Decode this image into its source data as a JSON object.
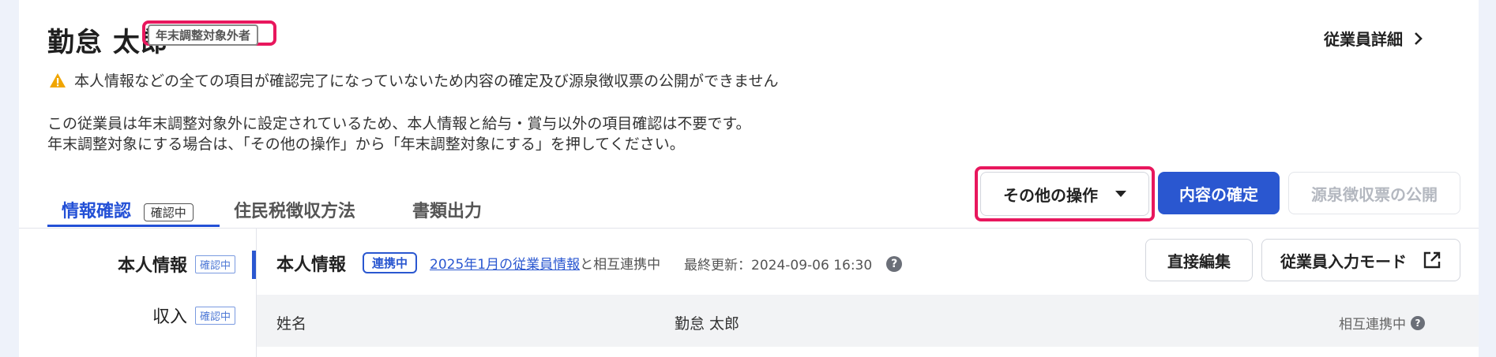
{
  "employee": {
    "name": "勤怠 太郎",
    "exclusion_badge": "年末調整対象外者",
    "detail_link": "従業員詳細"
  },
  "warning": "本人情報などの全ての項目が確認完了になっていないため内容の確定及び源泉徴収票の公開ができません",
  "info": {
    "line1": "この従業員は年末調整対象外に設定されているため、本人情報と給与・賞与以外の項目確認は不要です。",
    "line2": "年末調整対象にする場合は、「その他の操作」から「年末調整対象にする」を押してください。"
  },
  "tabs": [
    {
      "label": "情報確認",
      "chip": "確認中"
    },
    {
      "label": "住民税徴収方法"
    },
    {
      "label": "書類出力"
    }
  ],
  "actions": {
    "other": "その他の操作",
    "confirm": "内容の確定",
    "publish": "源泉徴収票の公開"
  },
  "sidebar": {
    "items": [
      {
        "label": "本人情報",
        "chip": "確認中"
      },
      {
        "label": "収入",
        "chip": "確認中"
      }
    ]
  },
  "section": {
    "title": "本人情報",
    "sync_chip": "連携中",
    "link_text": "2025年1月の従業員情報",
    "link_suffix": "と相互連携中",
    "updated": "最終更新：2024-09-06 16:30",
    "edit_button": "直接編集",
    "input_mode_button": "従業員入力モード"
  },
  "table": {
    "rows": [
      {
        "label": "姓名",
        "value": "勤怠 太郎",
        "status": "相互連携中"
      }
    ]
  },
  "colors": {
    "accent": "#2a57d0",
    "highlight": "#e8175d",
    "warning": "#f0a500"
  }
}
